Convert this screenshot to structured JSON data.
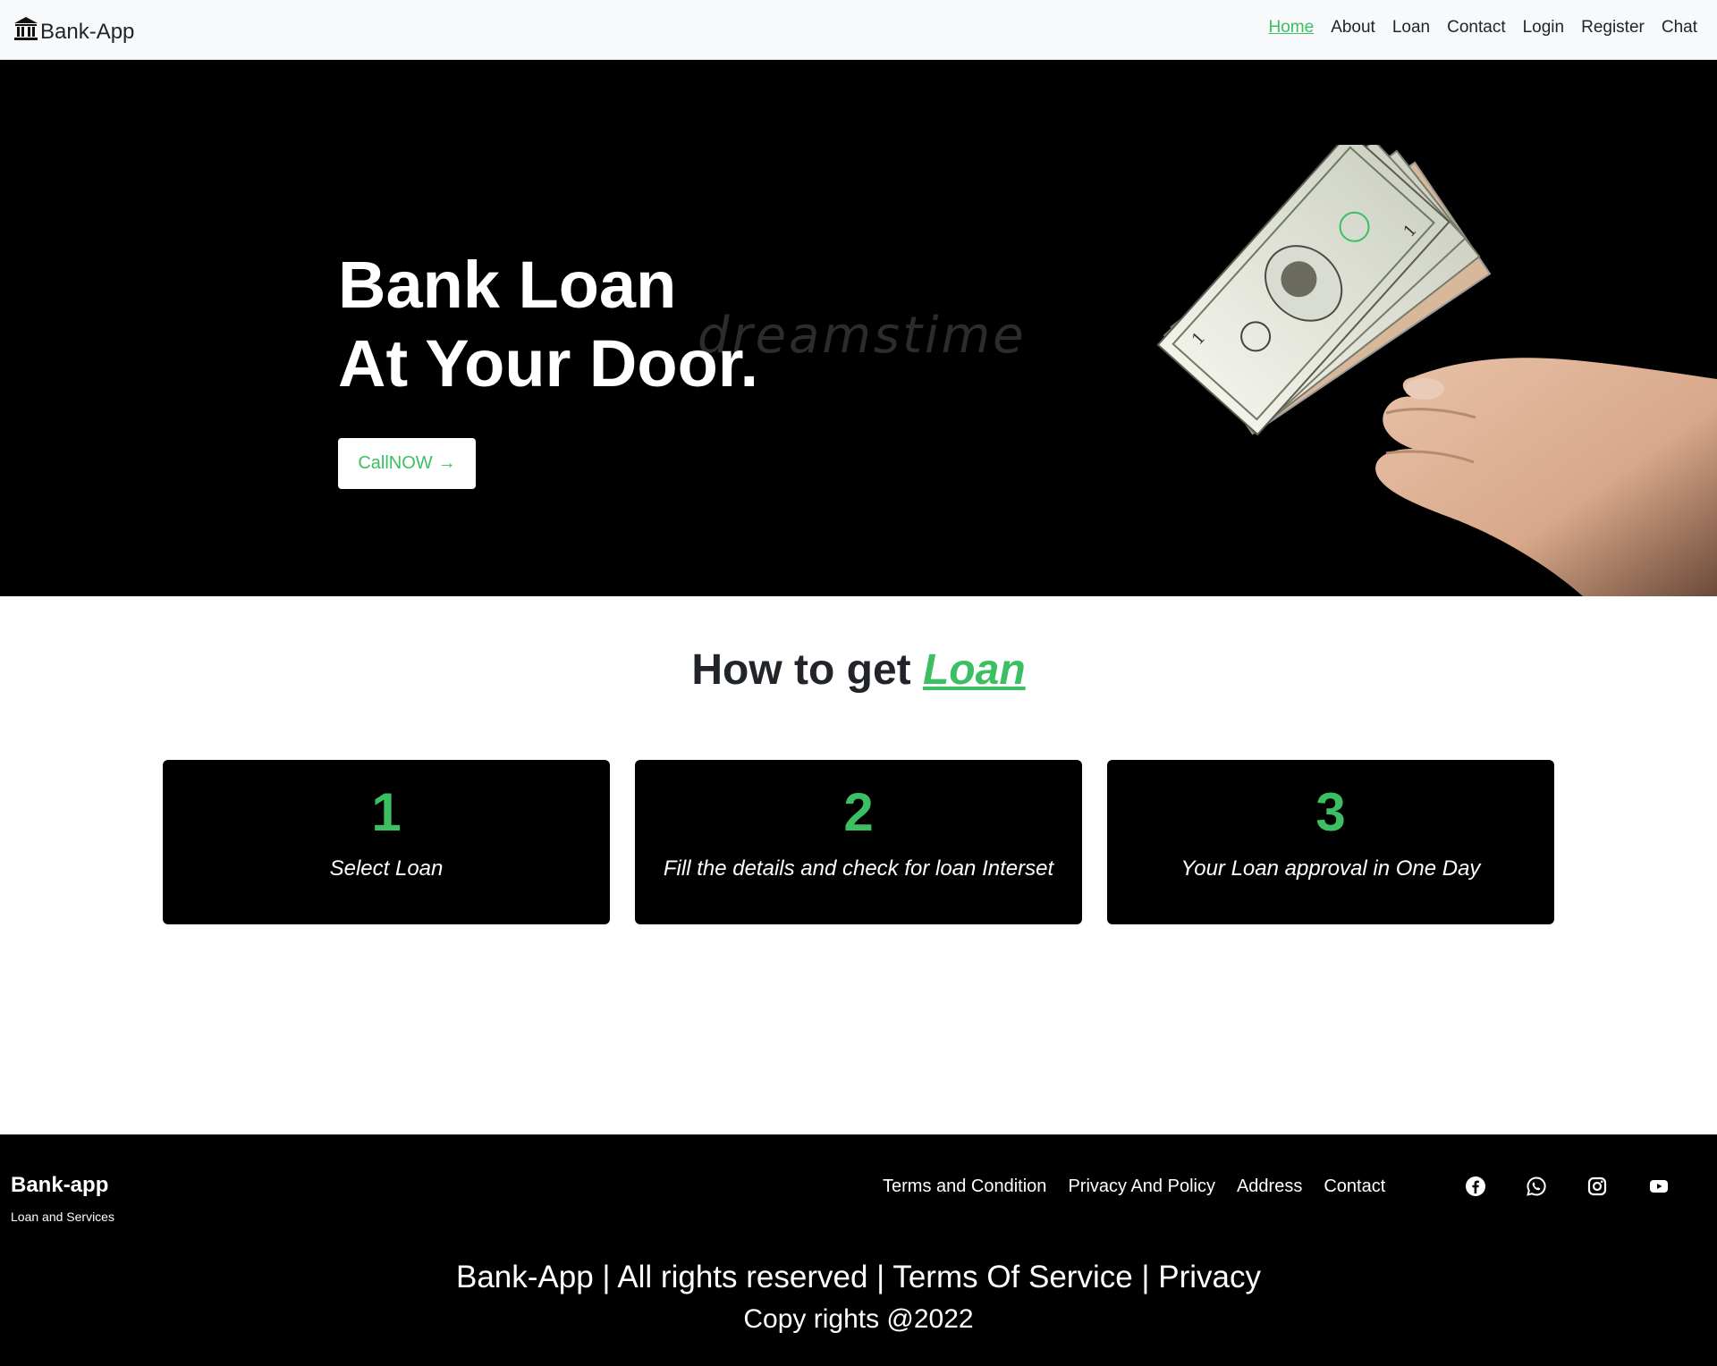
{
  "navbar": {
    "brand": "Bank-App",
    "brand_icon": "bank-building-icon",
    "links": [
      {
        "label": "Home",
        "active": true
      },
      {
        "label": "About",
        "active": false
      },
      {
        "label": "Loan",
        "active": false
      },
      {
        "label": "Contact",
        "active": false
      },
      {
        "label": "Login",
        "active": false
      },
      {
        "label": "Register",
        "active": false
      },
      {
        "label": "Chat",
        "active": false
      }
    ]
  },
  "hero": {
    "title_line1": "Bank Loan",
    "title_line2": "At Your Door.",
    "watermark": "dreamstime",
    "cta_label": "CallNOW",
    "cta_icon": "arrow-right-icon"
  },
  "how": {
    "title_prefix": "How to get",
    "title_accent": "Loan",
    "steps": [
      {
        "number": "1",
        "text": "Select Loan"
      },
      {
        "number": "2",
        "text": "Fill the details and check for loan Interset"
      },
      {
        "number": "3",
        "text": "Your Loan approval in One Day"
      }
    ]
  },
  "footer": {
    "brand": "Bank-app",
    "tagline": "Loan and Services",
    "links": [
      "Terms and Condition",
      "Privacy And Policy",
      "Address",
      "Contact"
    ],
    "social_icons": [
      "facebook-icon",
      "whatsapp-icon",
      "instagram-icon",
      "youtube-icon"
    ],
    "copyright_line": "Bank-App | All rights reserved | Terms Of Service | Privacy",
    "copyright_year": "Copy rights @2022"
  },
  "colors": {
    "accent": "#3cbf62",
    "dark": "#000000",
    "nav_bg": "#f8f9fa"
  }
}
